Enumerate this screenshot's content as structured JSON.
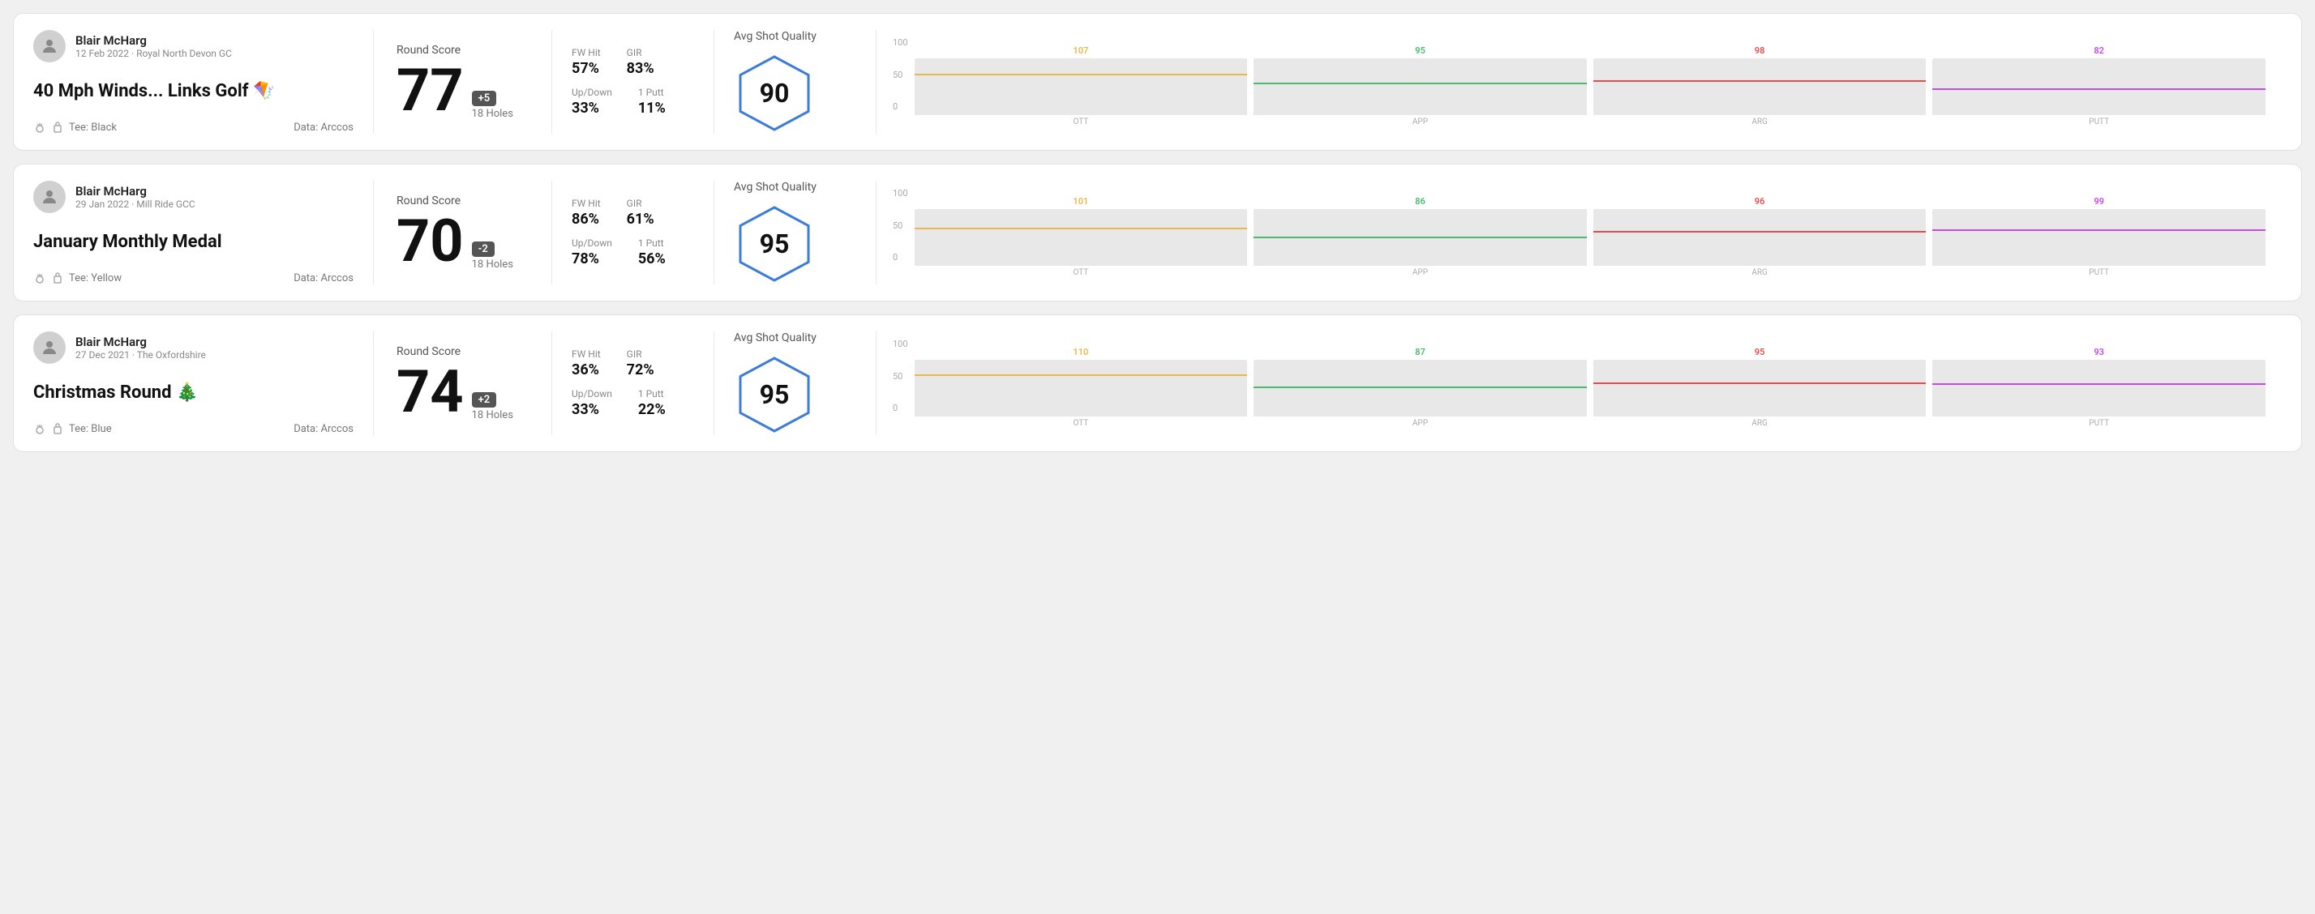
{
  "rounds": [
    {
      "id": "round1",
      "user": {
        "name": "Blair McHarg",
        "date": "12 Feb 2022",
        "course": "Royal North Devon GC"
      },
      "title": "40 Mph Winds... Links Golf",
      "title_emoji": "🪁",
      "tee": "Black",
      "data_source": "Data: Arccos",
      "score": {
        "label": "Round Score",
        "number": "77",
        "badge": "+5",
        "badge_sign": "plus",
        "holes": "18 Holes"
      },
      "stats": {
        "fw_hit_label": "FW Hit",
        "fw_hit_value": "57%",
        "gir_label": "GIR",
        "gir_value": "83%",
        "updown_label": "Up/Down",
        "updown_value": "33%",
        "oneputt_label": "1 Putt",
        "oneputt_value": "11%"
      },
      "quality": {
        "label": "Avg Shot Quality",
        "score": "90"
      },
      "chart": {
        "bars": [
          {
            "label": "OTT",
            "value": 107,
            "color": "#e8b84b",
            "pct": 70
          },
          {
            "label": "APP",
            "value": 95,
            "color": "#4cba6e",
            "pct": 55
          },
          {
            "label": "ARG",
            "value": 98,
            "color": "#e84b4b",
            "pct": 58
          },
          {
            "label": "PUTT",
            "value": 82,
            "color": "#c44be8",
            "pct": 45
          }
        ],
        "y_labels": [
          "100",
          "50",
          "0"
        ]
      }
    },
    {
      "id": "round2",
      "user": {
        "name": "Blair McHarg",
        "date": "29 Jan 2022",
        "course": "Mill Ride GCC"
      },
      "title": "January Monthly Medal",
      "title_emoji": "",
      "tee": "Yellow",
      "data_source": "Data: Arccos",
      "score": {
        "label": "Round Score",
        "number": "70",
        "badge": "-2",
        "badge_sign": "minus",
        "holes": "18 Holes"
      },
      "stats": {
        "fw_hit_label": "FW Hit",
        "fw_hit_value": "86%",
        "gir_label": "GIR",
        "gir_value": "61%",
        "updown_label": "Up/Down",
        "updown_value": "78%",
        "oneputt_label": "1 Putt",
        "oneputt_value": "56%"
      },
      "quality": {
        "label": "Avg Shot Quality",
        "score": "95"
      },
      "chart": {
        "bars": [
          {
            "label": "OTT",
            "value": 101,
            "color": "#e8b84b",
            "pct": 65
          },
          {
            "label": "APP",
            "value": 86,
            "color": "#4cba6e",
            "pct": 48
          },
          {
            "label": "ARG",
            "value": 96,
            "color": "#e84b4b",
            "pct": 58
          },
          {
            "label": "PUTT",
            "value": 99,
            "color": "#c44be8",
            "pct": 62
          }
        ],
        "y_labels": [
          "100",
          "50",
          "0"
        ]
      }
    },
    {
      "id": "round3",
      "user": {
        "name": "Blair McHarg",
        "date": "27 Dec 2021",
        "course": "The Oxfordshire"
      },
      "title": "Christmas Round",
      "title_emoji": "🎄",
      "tee": "Blue",
      "data_source": "Data: Arccos",
      "score": {
        "label": "Round Score",
        "number": "74",
        "badge": "+2",
        "badge_sign": "plus",
        "holes": "18 Holes"
      },
      "stats": {
        "fw_hit_label": "FW Hit",
        "fw_hit_value": "36%",
        "gir_label": "GIR",
        "gir_value": "72%",
        "updown_label": "Up/Down",
        "updown_value": "33%",
        "oneputt_label": "1 Putt",
        "oneputt_value": "22%"
      },
      "quality": {
        "label": "Avg Shot Quality",
        "score": "95"
      },
      "chart": {
        "bars": [
          {
            "label": "OTT",
            "value": 110,
            "color": "#e8b84b",
            "pct": 72
          },
          {
            "label": "APP",
            "value": 87,
            "color": "#4cba6e",
            "pct": 50
          },
          {
            "label": "ARG",
            "value": 95,
            "color": "#e84b4b",
            "pct": 57
          },
          {
            "label": "PUTT",
            "value": 93,
            "color": "#c44be8",
            "pct": 56
          }
        ],
        "y_labels": [
          "100",
          "50",
          "0"
        ]
      }
    }
  ]
}
